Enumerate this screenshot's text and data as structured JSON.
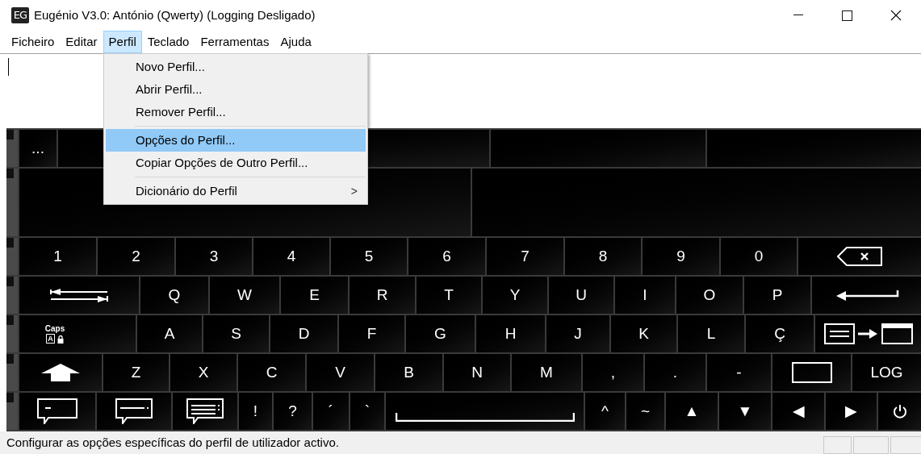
{
  "window": {
    "icon_text": "EG",
    "title": "Eugénio V3.0: António (Qwerty) (Logging Desligado)"
  },
  "menu_bar": [
    {
      "label": "Ficheiro",
      "selected": false
    },
    {
      "label": "Editar",
      "selected": false
    },
    {
      "label": "Perfil",
      "selected": true
    },
    {
      "label": "Teclado",
      "selected": false
    },
    {
      "label": "Ferramentas",
      "selected": false
    },
    {
      "label": "Ajuda",
      "selected": false
    }
  ],
  "dropdown": [
    {
      "kind": "item",
      "label": "Novo Perfil...",
      "selected": false
    },
    {
      "kind": "item",
      "label": "Abrir Perfil...",
      "selected": false
    },
    {
      "kind": "item",
      "label": "Remover Perfil...",
      "selected": false
    },
    {
      "kind": "separator"
    },
    {
      "kind": "item",
      "label": "Opções do Perfil...",
      "selected": true
    },
    {
      "kind": "item",
      "label": "Copiar Opções de Outro Perfil...",
      "selected": false
    },
    {
      "kind": "separator"
    },
    {
      "kind": "item",
      "label": "Dicionário do Perfil",
      "selected": false,
      "arrow": ">"
    }
  ],
  "keyboard": {
    "rows": [
      [
        {
          "kind": "char",
          "label": "..."
        },
        {
          "kind": "blank"
        },
        {
          "kind": "blank"
        },
        {
          "kind": "blank"
        }
      ],
      [
        {
          "kind": "blank"
        },
        {
          "kind": "blank"
        }
      ],
      [
        {
          "kind": "char",
          "label": "1"
        },
        {
          "kind": "char",
          "label": "2"
        },
        {
          "kind": "char",
          "label": "3"
        },
        {
          "kind": "char",
          "label": "4"
        },
        {
          "kind": "char",
          "label": "5"
        },
        {
          "kind": "char",
          "label": "6"
        },
        {
          "kind": "char",
          "label": "7"
        },
        {
          "kind": "char",
          "label": "8"
        },
        {
          "kind": "char",
          "label": "9"
        },
        {
          "kind": "char",
          "label": "0"
        },
        {
          "kind": "backspace"
        }
      ],
      [
        {
          "kind": "tab"
        },
        {
          "kind": "char",
          "label": "Q"
        },
        {
          "kind": "char",
          "label": "W"
        },
        {
          "kind": "char",
          "label": "E"
        },
        {
          "kind": "char",
          "label": "R"
        },
        {
          "kind": "char",
          "label": "T"
        },
        {
          "kind": "char",
          "label": "Y"
        },
        {
          "kind": "char",
          "label": "U"
        },
        {
          "kind": "char",
          "label": "I"
        },
        {
          "kind": "char",
          "label": "O"
        },
        {
          "kind": "char",
          "label": "P"
        },
        {
          "kind": "enter"
        }
      ],
      [
        {
          "kind": "caps",
          "label": "Caps",
          "badge": "A"
        },
        {
          "kind": "char",
          "label": "A"
        },
        {
          "kind": "char",
          "label": "S"
        },
        {
          "kind": "char",
          "label": "D"
        },
        {
          "kind": "char",
          "label": "F"
        },
        {
          "kind": "char",
          "label": "G"
        },
        {
          "kind": "char",
          "label": "H"
        },
        {
          "kind": "char",
          "label": "J"
        },
        {
          "kind": "char",
          "label": "K"
        },
        {
          "kind": "char",
          "label": "L"
        },
        {
          "kind": "char",
          "label": "Ç"
        },
        {
          "kind": "switch"
        }
      ],
      [
        {
          "kind": "shift"
        },
        {
          "kind": "char",
          "label": "Z"
        },
        {
          "kind": "char",
          "label": "X"
        },
        {
          "kind": "char",
          "label": "C"
        },
        {
          "kind": "char",
          "label": "V"
        },
        {
          "kind": "char",
          "label": "B"
        },
        {
          "kind": "char",
          "label": "N"
        },
        {
          "kind": "char",
          "label": "M"
        },
        {
          "kind": "char",
          "label": ","
        },
        {
          "kind": "char",
          "label": "."
        },
        {
          "kind": "char",
          "label": "-"
        },
        {
          "kind": "frame"
        },
        {
          "kind": "char",
          "label": "LOG"
        }
      ],
      [
        {
          "kind": "bubble1"
        },
        {
          "kind": "bubble2"
        },
        {
          "kind": "bubble3"
        },
        {
          "kind": "char",
          "label": "!"
        },
        {
          "kind": "char",
          "label": "?"
        },
        {
          "kind": "char",
          "label": "´"
        },
        {
          "kind": "char",
          "label": "`"
        },
        {
          "kind": "space"
        },
        {
          "kind": "char",
          "label": "^"
        },
        {
          "kind": "char",
          "label": "~"
        },
        {
          "kind": "char",
          "label": "▲"
        },
        {
          "kind": "char",
          "label": "▼"
        },
        {
          "kind": "char",
          "label": "◀"
        },
        {
          "kind": "char",
          "label": "▶"
        },
        {
          "kind": "power"
        }
      ]
    ]
  },
  "status_bar": {
    "text": "Configurar as opções específicas do perfil de utilizador activo."
  }
}
